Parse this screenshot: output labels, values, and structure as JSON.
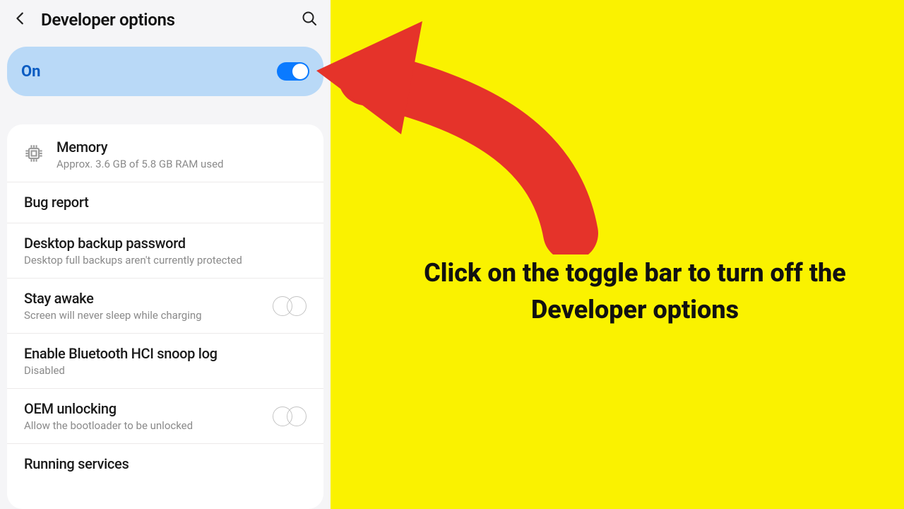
{
  "header": {
    "title": "Developer options"
  },
  "master": {
    "label": "On",
    "state": "on"
  },
  "rows": {
    "memory": {
      "title": "Memory",
      "sub": "Approx. 3.6 GB of 5.8 GB RAM used"
    },
    "bugreport": {
      "title": "Bug report"
    },
    "desktop": {
      "title": "Desktop backup password",
      "sub": "Desktop full backups aren't currently protected"
    },
    "stayawake": {
      "title": "Stay awake",
      "sub": "Screen will never sleep while charging"
    },
    "bthci": {
      "title": "Enable Bluetooth HCI snoop log",
      "sub": "Disabled"
    },
    "oem": {
      "title": "OEM unlocking",
      "sub": "Allow the bootloader to be unlocked"
    },
    "running": {
      "title": "Running services"
    }
  },
  "annotation": {
    "text": "Click on the toggle bar to turn off the Developer options"
  }
}
